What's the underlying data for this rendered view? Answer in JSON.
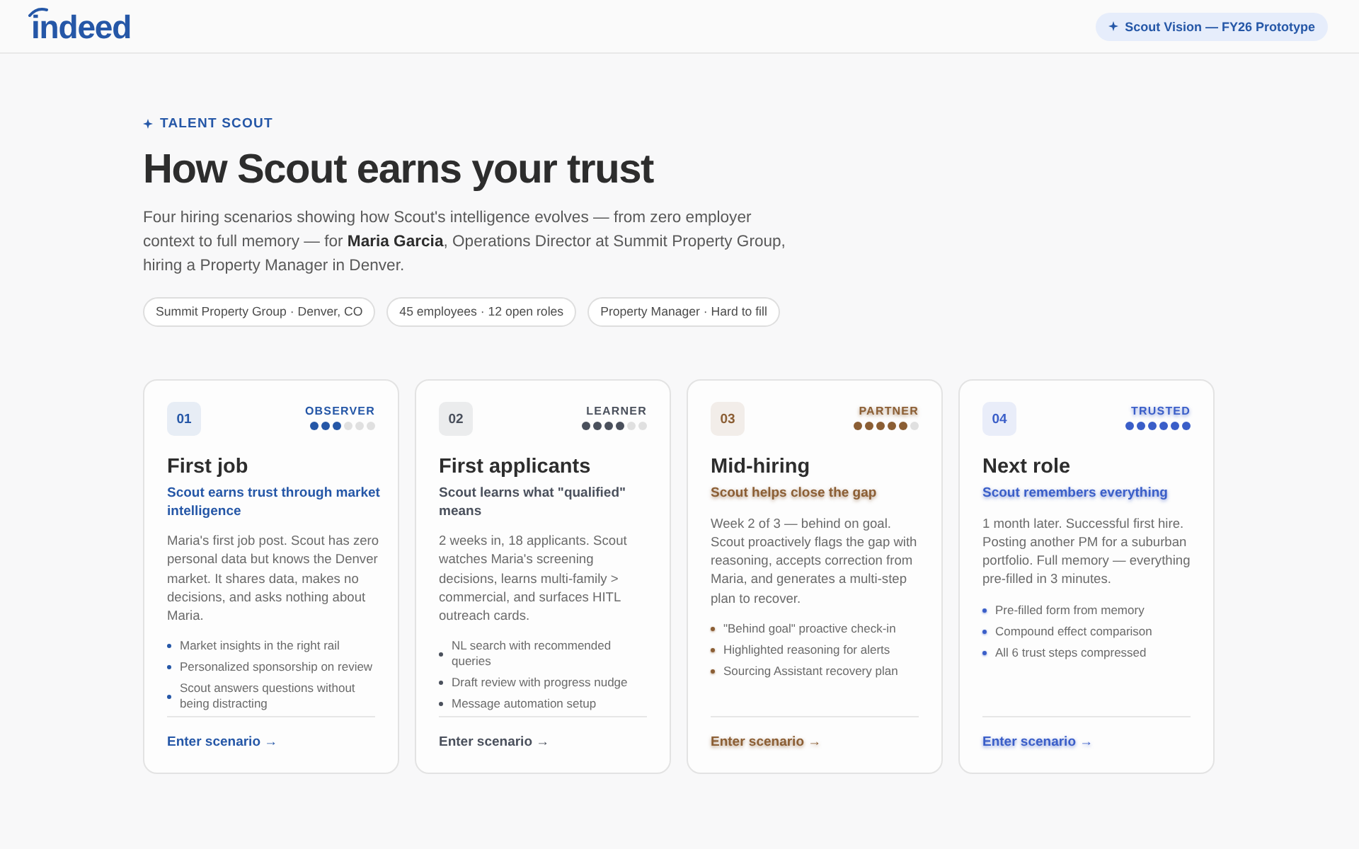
{
  "header": {
    "logo": "indeed",
    "badge": "Scout Vision — FY26 Prototype"
  },
  "intro": {
    "eyebrow": "TALENT SCOUT",
    "title": "How Scout earns your trust",
    "description": "Four hiring scenarios showing how Scout's intelligence evolves — from zero employer context to full memory — for **Maria Garcia**, Operations Director at Summit Property Group, hiring a Property Manager in Denver.",
    "chips": [
      "Summit Property Group · Denver, CO",
      "45 employees · 12 open roles",
      "Property Manager · Hard to fill"
    ]
  },
  "cards": [
    {
      "number": "01",
      "level_label": "OBSERVER",
      "stars": 3,
      "color": "#2557a7",
      "glow": false,
      "title": "First job",
      "subtitle": "Scout earns trust through market intelligence",
      "description": "Maria's first job post. Scout has zero personal data but knows the Denver market. It shares data, makes no decisions, and asks nothing about Maria.",
      "bullets": [
        "Market insights in the right rail",
        "Personalized sponsorship on review",
        "Scout answers questions without being distracting"
      ],
      "link": "Enter scenario →"
    },
    {
      "number": "02",
      "level_label": "LEARNER",
      "stars": 4,
      "color": "#4a505c",
      "glow": false,
      "title": "First applicants",
      "subtitle": "Scout learns what \"qualified\" means",
      "description": "2 weeks in, 18 applicants. Scout watches Maria's screening decisions, learns multi-family > commercial, and surfaces HITL outreach cards.",
      "bullets": [
        "NL search with recommended queries",
        "Draft review with progress nudge",
        "Message automation setup"
      ],
      "link": "Enter scenario →"
    },
    {
      "number": "03",
      "level_label": "PARTNER",
      "stars": 5,
      "color": "#8b5e34",
      "glow": true,
      "title": "Mid-hiring",
      "subtitle": "Scout helps close the gap",
      "description": "Week 2 of 3 — behind on goal. Scout proactively flags the gap with reasoning, accepts correction from Maria, and generates a multi-step plan to recover.",
      "bullets": [
        "\"Behind goal\" proactive check-in",
        "Highlighted reasoning for alerts",
        "Sourcing Assistant recovery plan"
      ],
      "link": "Enter scenario →"
    },
    {
      "number": "04",
      "level_label": "TRUSTED",
      "stars": 6,
      "color": "#3a5ec8",
      "glow": true,
      "title": "Next role",
      "subtitle": "Scout remembers everything",
      "description": "1 month later. Successful first hire. Posting another PM for a suburban portfolio. Full memory — everything pre-filled in 3 minutes.",
      "bullets": [
        "Pre-filled form from memory",
        "Compound effect comparison",
        "All 6 trust steps compressed"
      ],
      "link": "Enter scenario →"
    }
  ]
}
